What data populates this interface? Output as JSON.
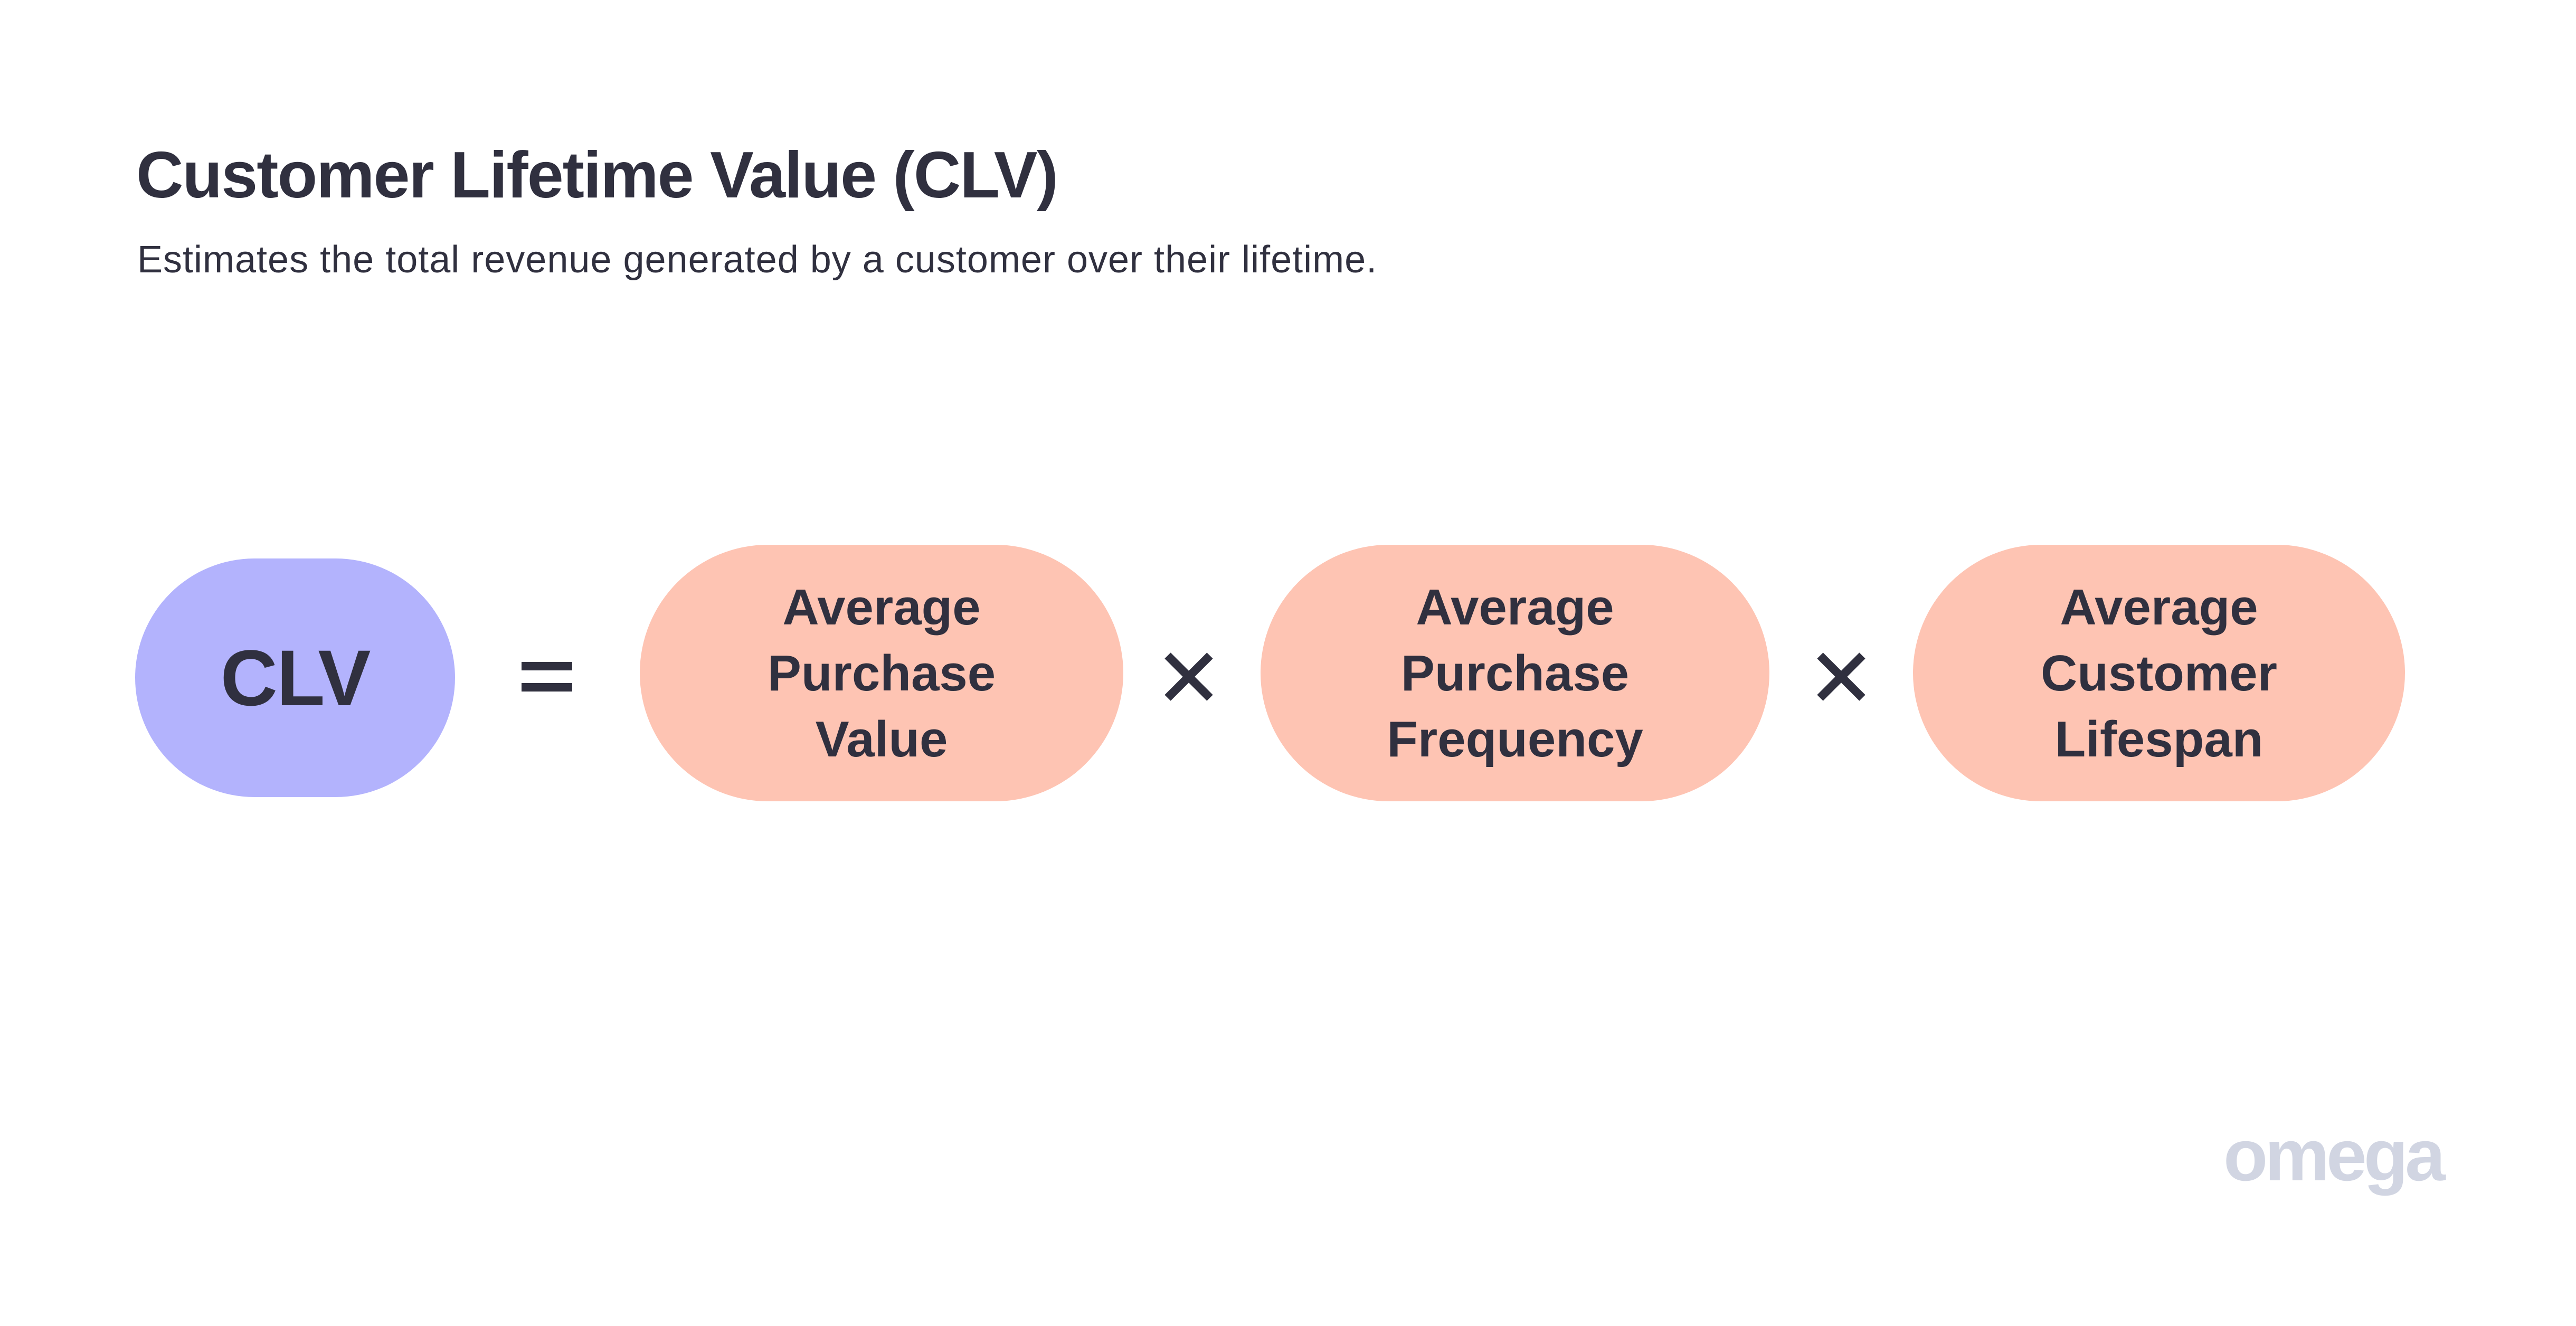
{
  "header": {
    "title": "Customer Lifetime Value (CLV)",
    "subtitle": "Estimates the total revenue generated by a customer over their lifetime."
  },
  "formula": {
    "result": {
      "label": "CLV",
      "color": "#B3B3FD"
    },
    "equals_symbol": "equals-icon",
    "operator_symbol": "times-icon",
    "factors": [
      {
        "lines": [
          "Average",
          "Purchase",
          "Value"
        ],
        "color": "#FEC4B3"
      },
      {
        "lines": [
          "Average",
          "Purchase",
          "Frequency"
        ],
        "color": "#FEC4B3"
      },
      {
        "lines": [
          "Average",
          "Customer",
          "Lifespan"
        ],
        "color": "#FEC4B3"
      }
    ]
  },
  "branding": {
    "logo_text": "omega",
    "color": "#D1D5E2"
  },
  "colors": {
    "text": "#30303F",
    "background": "#FFFFFF"
  }
}
